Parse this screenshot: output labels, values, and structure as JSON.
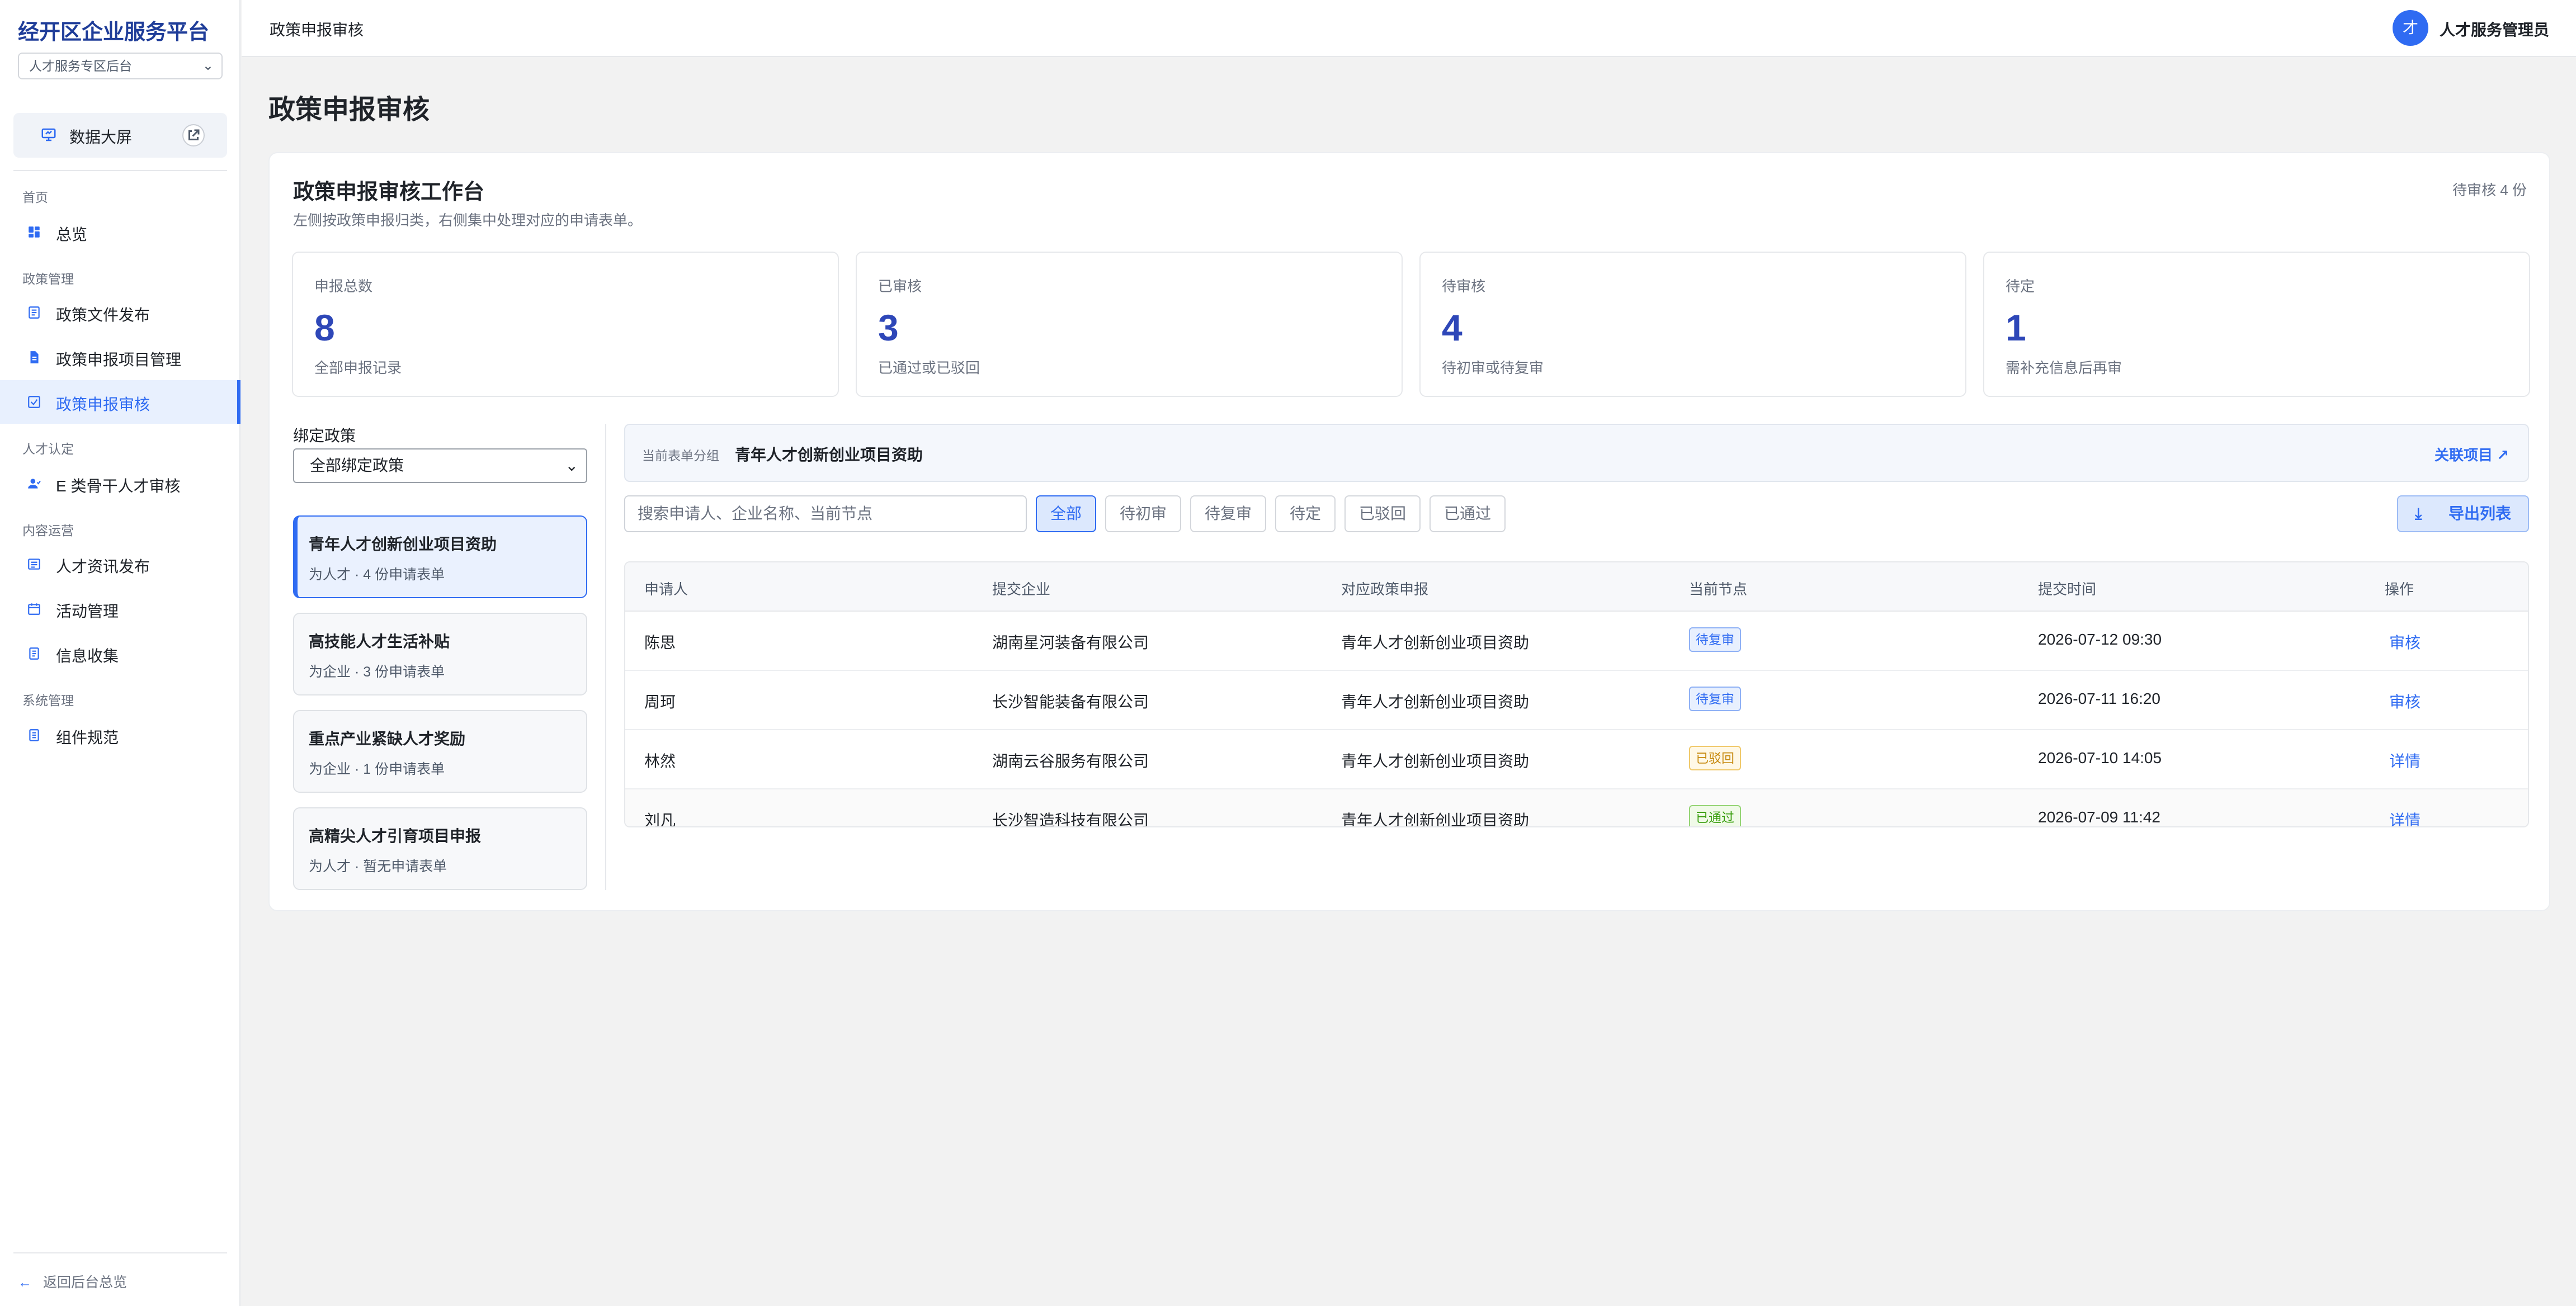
{
  "sidebar": {
    "brand": "经开区企业服务平台",
    "portal": "人才服务专区后台",
    "bigscreen_label": "数据大屏",
    "sections": {
      "home": "首页",
      "policy": "政策管理",
      "talent": "人才认定",
      "content": "内容运营",
      "system": "系统管理"
    },
    "items": [
      {
        "label": "总览",
        "icon": "dashboard-icon"
      },
      {
        "label": "政策文件发布",
        "icon": "document-icon"
      },
      {
        "label": "政策申报项目管理",
        "icon": "file-icon"
      },
      {
        "label": "政策申报审核",
        "icon": "checkbox-icon",
        "active": true
      },
      {
        "label": "E 类骨干人才审核",
        "icon": "user-icon"
      },
      {
        "label": "人才资讯发布",
        "icon": "news-icon"
      },
      {
        "label": "活动管理",
        "icon": "calendar-icon"
      },
      {
        "label": "信息收集",
        "icon": "form-icon"
      },
      {
        "label": "组件规范",
        "icon": "component-icon"
      }
    ],
    "back_label": "返回后台总览"
  },
  "topbar": {
    "breadcrumb": "政策申报审核",
    "avatar_text": "才",
    "user_name": "人才服务管理员"
  },
  "page": {
    "title": "政策申报审核",
    "card_title": "政策申报审核工作台",
    "card_subtitle": "左侧按政策申报归类，右侧集中处理对应的申请表单。",
    "pending_count": "待审核 4 份"
  },
  "stats": [
    {
      "label": "申报总数",
      "value": "8",
      "note": "全部申报记录"
    },
    {
      "label": "已审核",
      "value": "3",
      "note": "已通过或已驳回"
    },
    {
      "label": "待审核",
      "value": "4",
      "note": "待初审或待复审"
    },
    {
      "label": "待定",
      "value": "1",
      "note": "需补充信息后再审"
    }
  ],
  "bind": {
    "label": "绑定政策",
    "selected": "全部绑定政策"
  },
  "policies": [
    {
      "title": "青年人才创新创业项目资助",
      "sub": "为人才 · 4 份申请表单",
      "active": true
    },
    {
      "title": "高技能人才生活补贴",
      "sub": "为企业 · 3 份申请表单"
    },
    {
      "title": "重点产业紧缺人才奖励",
      "sub": "为企业 · 1 份申请表单"
    },
    {
      "title": "高精尖人才引育项目申报",
      "sub": "为人才 · 暂无申请表单"
    }
  ],
  "group": {
    "label": "当前表单分组",
    "value": "青年人才创新创业项目资助",
    "link": "关联项目 ↗"
  },
  "search": {
    "placeholder": "搜索申请人、企业名称、当前节点",
    "value": ""
  },
  "filters": [
    "全部",
    "待初审",
    "待复审",
    "待定",
    "已驳回",
    "已通过"
  ],
  "export_label": "导出列表",
  "table": {
    "headers": [
      "申请人",
      "提交企业",
      "对应政策申报",
      "当前节点",
      "提交时间",
      "操作"
    ],
    "rows": [
      {
        "applicant": "陈思",
        "company": "湖南星河装备有限公司",
        "policy": "青年人才创新创业项目资助",
        "status": "待复审",
        "time": "2026-07-12 09:30",
        "action": "审核"
      },
      {
        "applicant": "周珂",
        "company": "长沙智能装备有限公司",
        "policy": "青年人才创新创业项目资助",
        "status": "待复审",
        "time": "2026-07-11 16:20",
        "action": "审核"
      },
      {
        "applicant": "林然",
        "company": "湖南云谷服务有限公司",
        "policy": "青年人才创新创业项目资助",
        "status": "已驳回",
        "time": "2026-07-10 14:05",
        "action": "详情"
      },
      {
        "applicant": "刘凡",
        "company": "长沙智造科技有限公司",
        "policy": "青年人才创新创业项目资助",
        "status": "已通过",
        "time": "2026-07-09 11:42",
        "action": "详情"
      }
    ]
  },
  "colors": {
    "accent": "#2f6bf2",
    "brand": "#1f3d99",
    "stat_value": "#2e47b8",
    "badge_review": "#2f6bf2",
    "badge_rejected": "#c78a0f",
    "badge_passed": "#389e0d"
  }
}
